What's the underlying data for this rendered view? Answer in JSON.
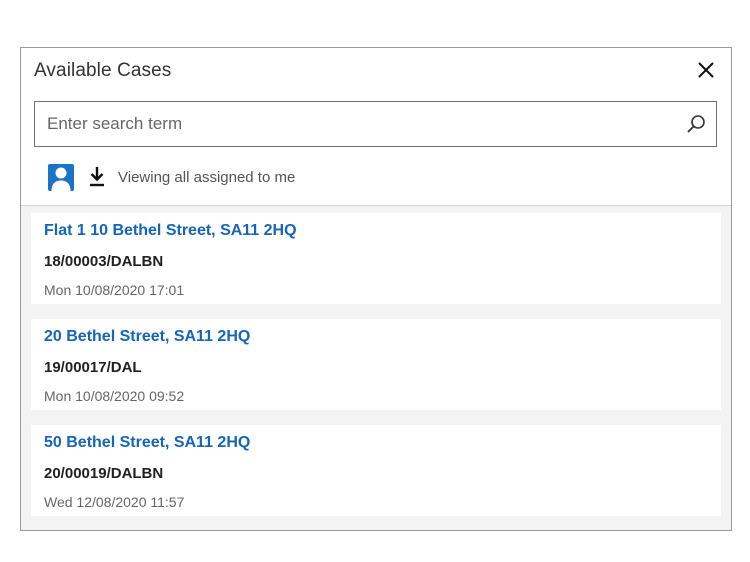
{
  "dialog": {
    "title": "Available Cases",
    "close_icon": "close-icon"
  },
  "search": {
    "placeholder": "Enter search term",
    "value": "",
    "icon": "search-icon"
  },
  "toolbar": {
    "user_icon": "user-icon",
    "download_icon": "download-icon",
    "view_label": "Viewing all assigned to me"
  },
  "cases": [
    {
      "title": "Flat 1 10 Bethel Street, SA11 2HQ",
      "reference": "18/00003/DALBN",
      "date": "Mon 10/08/2020 17:01"
    },
    {
      "title": "20 Bethel Street, SA11 2HQ",
      "reference": "19/00017/DAL",
      "date": "Mon 10/08/2020 09:52"
    },
    {
      "title": "50 Bethel Street, SA11 2HQ",
      "reference": "20/00019/DALBN",
      "date": "Wed 12/08/2020 11:57"
    }
  ],
  "colors": {
    "link": "#1565b8",
    "accent": "#1a73c6",
    "list_background": "#f3f3f3"
  }
}
